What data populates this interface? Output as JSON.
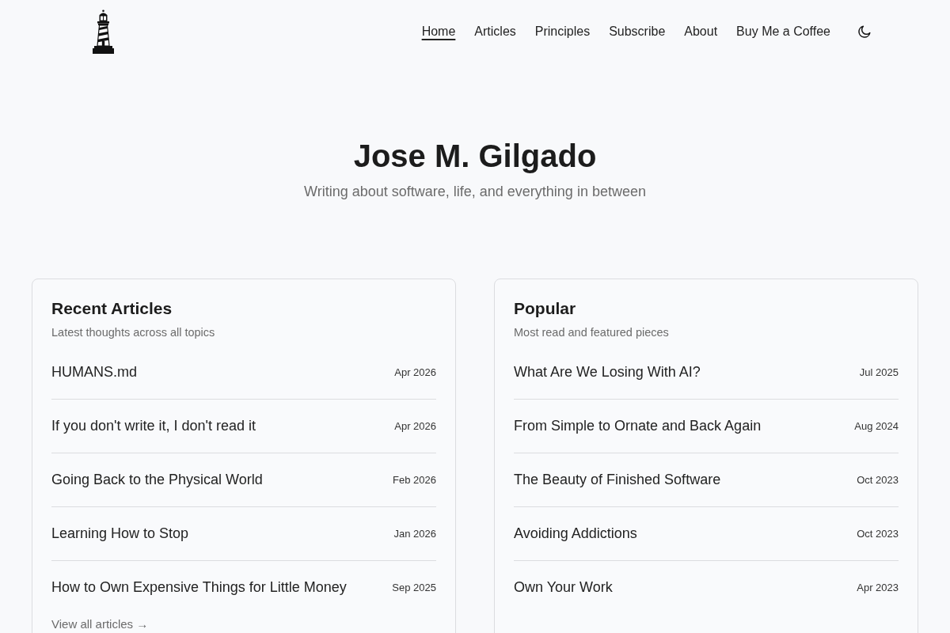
{
  "header": {
    "nav": [
      {
        "label": "Home",
        "selected": true
      },
      {
        "label": "Articles",
        "selected": false
      },
      {
        "label": "Principles",
        "selected": false
      },
      {
        "label": "Subscribe",
        "selected": false
      },
      {
        "label": "About",
        "selected": false
      },
      {
        "label": "Buy Me a Coffee",
        "selected": false
      }
    ]
  },
  "hero": {
    "title": "Jose M. Gilgado",
    "subtitle": "Writing about software, life, and everything in between"
  },
  "sections": [
    {
      "title": "Recent Articles",
      "subtitle": "Latest thoughts across all topics",
      "articles": [
        {
          "title": "HUMANS.md",
          "date": "Apr 2026"
        },
        {
          "title": "If you don't write it, I don't read it",
          "date": "Apr 2026"
        },
        {
          "title": "Going Back to the Physical World",
          "date": "Feb 2026"
        },
        {
          "title": "Learning How to Stop",
          "date": "Jan 2026"
        },
        {
          "title": "How to Own Expensive Things for Little Money",
          "date": "Sep 2025"
        }
      ],
      "link": "View all articles →"
    },
    {
      "title": "Popular",
      "subtitle": "Most read and featured pieces",
      "articles": [
        {
          "title": "What Are We Losing With AI?",
          "date": "Jul 2025"
        },
        {
          "title": "From Simple to Ornate and Back Again",
          "date": "Aug 2024"
        },
        {
          "title": "The Beauty of Finished Software",
          "date": "Oct 2023"
        },
        {
          "title": "Avoiding Addictions",
          "date": "Oct 2023"
        },
        {
          "title": "Own Your Work",
          "date": "Apr 2023"
        }
      ]
    }
  ]
}
